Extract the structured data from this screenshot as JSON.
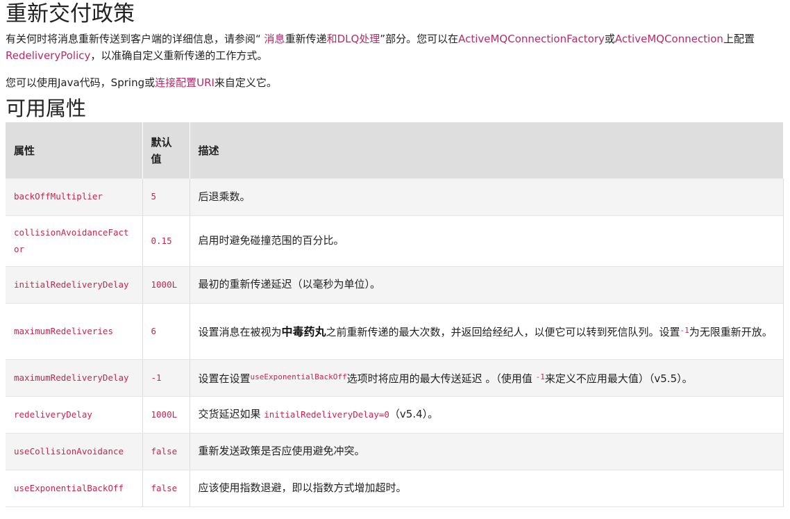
{
  "title": "重新交付政策",
  "intro": {
    "p1_a": "有关何时将消息重新传送到客户端的详细信息，请参阅“",
    "p1_link1": " 消息",
    "p1_b": "重新传递",
    "p1_link2": "和DLQ处理",
    "p1_c": "”部分。您可以在",
    "p1_link3": "ActiveMQConnectionFactory",
    "p1_d": "或",
    "p1_link4": "ActiveMQConnection",
    "p1_e": "上配置",
    "p1_link5": "RedeliveryPolicy",
    "p1_f": "，以准确自定义重新传递的工作方式。",
    "p2_a": "您可以使用Java代码，Spring或",
    "p2_link": "连接配置URI",
    "p2_b": "来自定义它。"
  },
  "section_title": "可用属性",
  "table": {
    "headers": {
      "property": "属性",
      "default": "默认值",
      "description": "描述"
    },
    "rows": [
      {
        "property": "backOffMultiplier",
        "default": "5",
        "description": "后退乘数。"
      },
      {
        "property": "collisionAvoidanceFactor",
        "default": "0.15",
        "description": "启用时避免碰撞范围的百分比。"
      },
      {
        "property": "initialRedeliveryDelay",
        "default": "1000L",
        "description": "最初的重新传递延迟（以毫秒为单位）。"
      },
      {
        "property": "maximumRedeliveries",
        "default": "6",
        "description_a": "设置消息在被视为",
        "description_strong": "中毒药丸",
        "description_b": "之前重新传递的最大次数，并返回给经纪人，以便它可以转到死信队列。设置",
        "description_code": "-1",
        "description_c": "为无限重新开放。"
      },
      {
        "property": "maximumRedeliveryDelay",
        "default": "-1",
        "description_a": "设置在设置",
        "description_code1": "useExponentialBackOff",
        "description_b": "选项时将应用的最大传送延迟 。（使用值 ",
        "description_code2": "-1",
        "description_c": "来定义不应用最大值）（v5.5）。"
      },
      {
        "property": "redeliveryDelay",
        "default": "1000L",
        "description_a": "交货延迟如果 ",
        "description_code": "initialRedeliveryDelay=0",
        "description_b": "（v5.4）。"
      },
      {
        "property": "useCollisionAvoidance",
        "default": "false",
        "description": "重新发送政策是否应使用避免冲突。"
      },
      {
        "property": "useExponentialBackOff",
        "default": "false",
        "description": "应该使用指数退避，即以指数方式增加超时。"
      }
    ]
  },
  "colors": {
    "link": "#b92a67",
    "code": "#c7254e",
    "header_bg": "#dedede",
    "alt_row_bg": "#f4f4f4"
  }
}
